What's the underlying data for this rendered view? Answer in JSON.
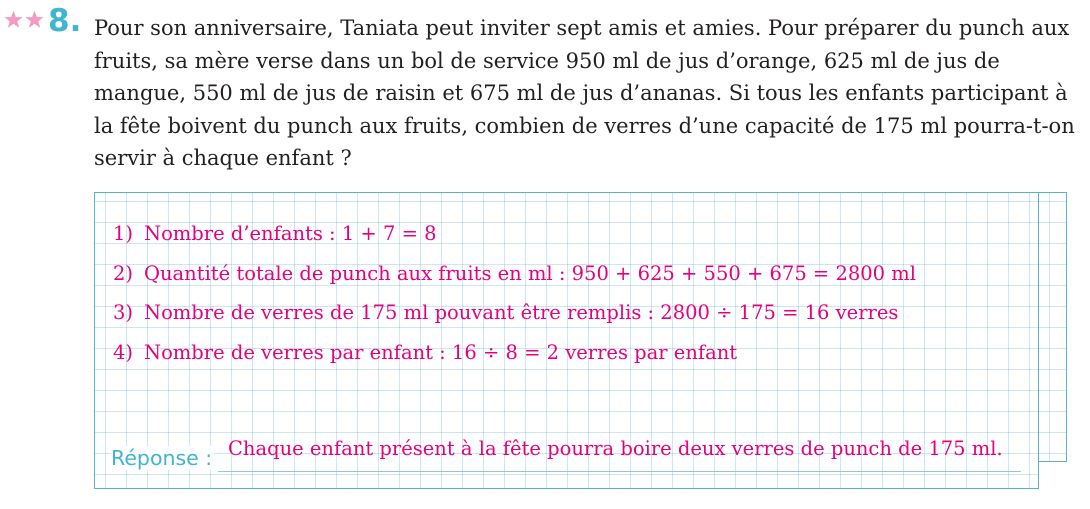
{
  "exercise": {
    "number": "8.",
    "difficulty_stars": 2,
    "star_color": "#f49ac1",
    "number_color": "#3fb6cf",
    "question": "Pour son anniversaire, Taniata peut inviter sept amis et amies. Pour préparer du punch aux fruits, sa mère verse dans un bol de service 950 ml de jus d’orange, 625 ml de jus de mangue, 550 ml de jus de raisin et 675 ml de jus d’ananas. Si tous les enfants participant à la fête boivent du punch aux fruits, combien de verres d’une capacité de 175 ml pourra-t-on servir à chaque enfant ?"
  },
  "solution": {
    "color": "#e6007e",
    "steps": [
      {
        "number": "1)",
        "text": "Nombre d’enfants : 1 + 7 = 8"
      },
      {
        "number": "2)",
        "text": "Quantité totale de punch aux fruits en ml : 950 + 625 + 550 + 675 = 2800 ml"
      },
      {
        "number": "3)",
        "text": "Nombre de verres de 175 ml pouvant être remplis : 2800 ÷ 175 = 16 verres"
      },
      {
        "number": "4)",
        "text": "Nombre de verres par enfant : 16 ÷ 8 = 2 verres par enfant"
      }
    ]
  },
  "answer": {
    "label": "Réponse :",
    "text": "Chaque enfant présent à la fête pourra boire deux verres de punch de 175 ml.",
    "label_color": "#3fb6cf"
  }
}
